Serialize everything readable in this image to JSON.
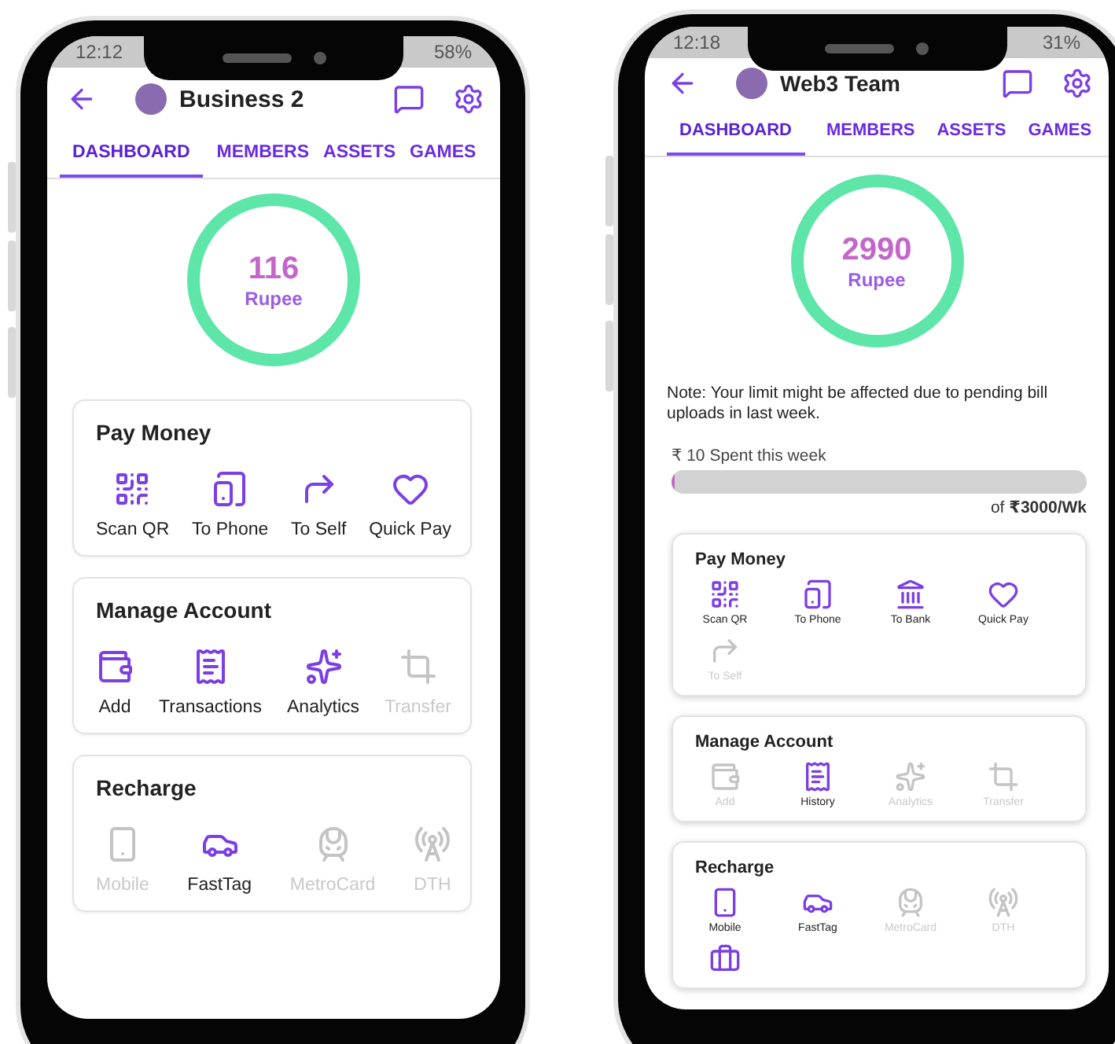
{
  "phones": [
    {
      "status_bar": {
        "time": "12:12",
        "battery": "58%"
      },
      "header": {
        "title": "Business 2"
      },
      "tabs": [
        {
          "label": "DASHBOARD",
          "selected": true
        },
        {
          "label": "MEMBERS",
          "selected": false
        },
        {
          "label": "ASSETS",
          "selected": false
        },
        {
          "label": "GAMES",
          "selected": false
        }
      ],
      "balance": {
        "amount": "116",
        "unit": "Rupee"
      },
      "sections": [
        {
          "title": "Pay Money",
          "items": [
            {
              "kind": "qr",
              "label": "Scan QR",
              "disabled": false
            },
            {
              "kind": "phone-in",
              "label": "To Phone",
              "disabled": false
            },
            {
              "kind": "self",
              "label": "To Self",
              "disabled": false
            },
            {
              "kind": "heart",
              "label": "Quick Pay",
              "disabled": false
            }
          ]
        },
        {
          "title": "Manage Account",
          "items": [
            {
              "kind": "wallet",
              "label": "Add",
              "disabled": false
            },
            {
              "kind": "receipt",
              "label": "Transactions",
              "disabled": false
            },
            {
              "kind": "sparkle",
              "label": "Analytics",
              "disabled": false
            },
            {
              "kind": "crop",
              "label": "Transfer",
              "disabled": true
            }
          ]
        },
        {
          "title": "Recharge",
          "items": [
            {
              "kind": "mobile",
              "label": "Mobile",
              "disabled": true
            },
            {
              "kind": "car",
              "label": "FastTag",
              "disabled": false
            },
            {
              "kind": "train",
              "label": "MetroCard",
              "disabled": true
            },
            {
              "kind": "tower",
              "label": "DTH",
              "disabled": true
            }
          ]
        }
      ]
    },
    {
      "status_bar": {
        "time": "12:18",
        "battery": "31%"
      },
      "header": {
        "title": "Web3 Team"
      },
      "tabs": [
        {
          "label": "DASHBOARD",
          "selected": true
        },
        {
          "label": "MEMBERS",
          "selected": false
        },
        {
          "label": "ASSETS",
          "selected": false
        },
        {
          "label": "GAMES",
          "selected": false
        }
      ],
      "balance": {
        "amount": "2990",
        "unit": "Rupee"
      },
      "note": "Note: Your limit might be affected due to pending bill uploads in last week.",
      "limit": {
        "spent": "₹ 10 Spent this week",
        "level": 0.0033,
        "total_prefix": "of ",
        "total": "₹3000/Wk"
      },
      "sections": [
        {
          "title": "Pay Money",
          "items": [
            {
              "kind": "qr",
              "label": "Scan QR",
              "disabled": false
            },
            {
              "kind": "phone-in",
              "label": "To Phone",
              "disabled": false
            },
            {
              "kind": "bank",
              "label": "To Bank",
              "disabled": false
            },
            {
              "kind": "heart",
              "label": "Quick Pay",
              "disabled": false
            },
            {
              "kind": "self",
              "label": "To Self",
              "disabled": true
            }
          ]
        },
        {
          "title": "Manage Account",
          "items": [
            {
              "kind": "wallet",
              "label": "Add",
              "disabled": true
            },
            {
              "kind": "receipt",
              "label": "History",
              "disabled": false
            },
            {
              "kind": "sparkle",
              "label": "Analytics",
              "disabled": true
            },
            {
              "kind": "crop",
              "label": "Transfer",
              "disabled": true
            }
          ]
        },
        {
          "title": "Recharge",
          "items": [
            {
              "kind": "mobile",
              "label": "Mobile",
              "disabled": false
            },
            {
              "kind": "car",
              "label": "FastTag",
              "disabled": false
            },
            {
              "kind": "train",
              "label": "MetroCard",
              "disabled": true
            },
            {
              "kind": "tower",
              "label": "DTH",
              "disabled": true
            },
            {
              "kind": "briefcase",
              "disabled": false
            }
          ]
        }
      ]
    }
  ]
}
